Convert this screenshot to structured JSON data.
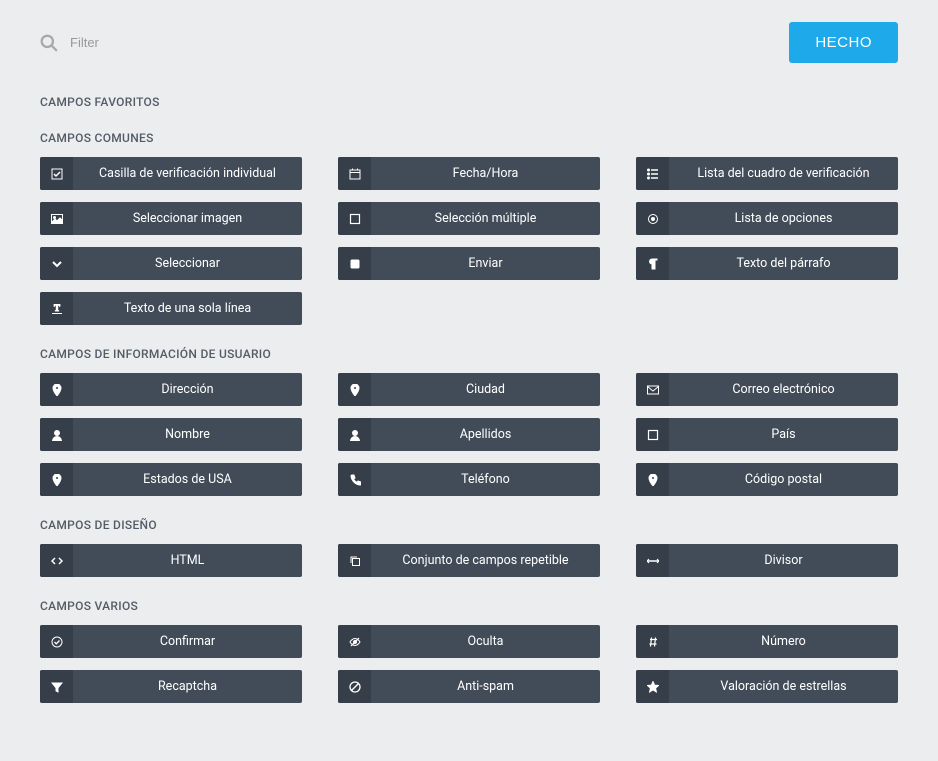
{
  "search": {
    "placeholder": "Filter"
  },
  "done_label": "HECHO",
  "sections": {
    "favorites": {
      "title": "CAMPOS FAVORITOS",
      "items": []
    },
    "common": {
      "title": "CAMPOS COMUNES",
      "items": [
        {
          "icon": "checkbox-single",
          "label": "Casilla de verificación individual"
        },
        {
          "icon": "calendar",
          "label": "Fecha/Hora"
        },
        {
          "icon": "list-check",
          "label": "Lista del cuadro de verificación"
        },
        {
          "icon": "image",
          "label": "Seleccionar imagen"
        },
        {
          "icon": "square-outline",
          "label": "Selección múltiple"
        },
        {
          "icon": "target",
          "label": "Lista de opciones"
        },
        {
          "icon": "chevron-down",
          "label": "Seleccionar"
        },
        {
          "icon": "square-filled",
          "label": "Enviar"
        },
        {
          "icon": "paragraph",
          "label": "Texto del párrafo"
        },
        {
          "icon": "text-width",
          "label": "Texto de una sola línea"
        }
      ]
    },
    "userinfo": {
      "title": "CAMPOS DE INFORMACIÓN DE USUARIO",
      "items": [
        {
          "icon": "pin",
          "label": "Dirección"
        },
        {
          "icon": "pin",
          "label": "Ciudad"
        },
        {
          "icon": "envelope",
          "label": "Correo electrónico"
        },
        {
          "icon": "user",
          "label": "Nombre"
        },
        {
          "icon": "user",
          "label": "Apellidos"
        },
        {
          "icon": "square-outline",
          "label": "País"
        },
        {
          "icon": "pin",
          "label": "Estados de USA"
        },
        {
          "icon": "phone",
          "label": "Teléfono"
        },
        {
          "icon": "pin",
          "label": "Código postal"
        }
      ]
    },
    "layout": {
      "title": "CAMPOS DE DISEÑO",
      "items": [
        {
          "icon": "code",
          "label": "HTML"
        },
        {
          "icon": "copy",
          "label": "Conjunto de campos repetible"
        },
        {
          "icon": "divider",
          "label": "Divisor"
        }
      ]
    },
    "misc": {
      "title": "CAMPOS VARIOS",
      "items": [
        {
          "icon": "circle-check",
          "label": "Confirmar"
        },
        {
          "icon": "eye-slash",
          "label": "Oculta"
        },
        {
          "icon": "hash",
          "label": "Número"
        },
        {
          "icon": "filter",
          "label": "Recaptcha"
        },
        {
          "icon": "ban",
          "label": "Anti-spam"
        },
        {
          "icon": "star",
          "label": "Valoración de estrellas"
        }
      ]
    }
  }
}
